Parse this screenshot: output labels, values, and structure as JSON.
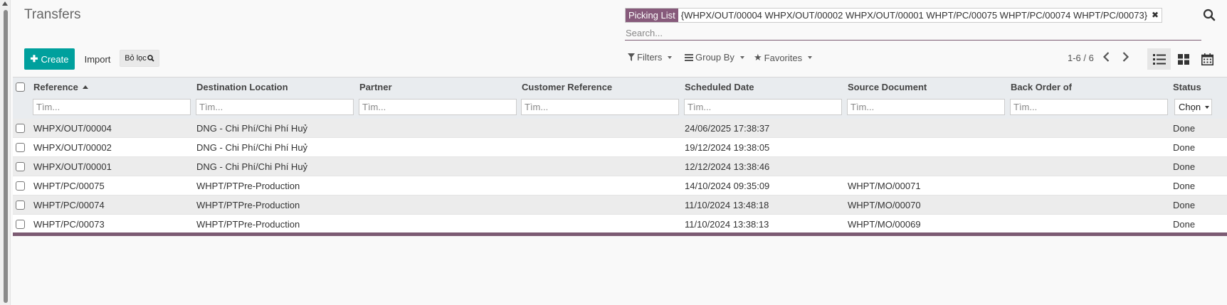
{
  "page_title": "Transfers",
  "search": {
    "facet_label": "Picking List",
    "facet_value": "{WHPX/OUT/00004 WHPX/OUT/00002 WHPX/OUT/00001 WHPT/PC/00075 WHPT/PC/00074 WHPT/PC/00073}",
    "placeholder": "Search..."
  },
  "toolbar": {
    "create_label": "Create",
    "import_label": "Import",
    "boloc_label": "Bỏ lọc",
    "filters_label": "Filters",
    "groupby_label": "Group By",
    "favorites_label": "Favorites",
    "pager_text": "1-6 / 6"
  },
  "table": {
    "columns": [
      "Reference",
      "Destination Location",
      "Partner",
      "Customer Reference",
      "Scheduled Date",
      "Source Document",
      "Back Order of",
      "Status"
    ],
    "filter_placeholder": "Tìm...",
    "status_select_value": "Chọn",
    "rows": [
      {
        "reference": "WHPX/OUT/00004",
        "destination": "DNG - Chi Phí/Chi Phí Huỷ",
        "partner": "",
        "customer_ref": "",
        "scheduled": "24/06/2025 17:38:37",
        "source": "",
        "backorder": "",
        "status": "Done"
      },
      {
        "reference": "WHPX/OUT/00002",
        "destination": "DNG - Chi Phí/Chi Phí Huỷ",
        "partner": "",
        "customer_ref": "",
        "scheduled": "19/12/2024 19:38:05",
        "source": "",
        "backorder": "",
        "status": "Done"
      },
      {
        "reference": "WHPX/OUT/00001",
        "destination": "DNG - Chi Phí/Chi Phí Huỷ",
        "partner": "",
        "customer_ref": "",
        "scheduled": "12/12/2024 13:38:46",
        "source": "",
        "backorder": "",
        "status": "Done"
      },
      {
        "reference": "WHPT/PC/00075",
        "destination": "WHPT/PTPre-Production",
        "partner": "",
        "customer_ref": "",
        "scheduled": "14/10/2024 09:35:09",
        "source": "WHPT/MO/00071",
        "backorder": "",
        "status": "Done"
      },
      {
        "reference": "WHPT/PC/00074",
        "destination": "WHPT/PTPre-Production",
        "partner": "",
        "customer_ref": "",
        "scheduled": "11/10/2024 13:48:18",
        "source": "WHPT/MO/00070",
        "backorder": "",
        "status": "Done"
      },
      {
        "reference": "WHPT/PC/00073",
        "destination": "WHPT/PTPre-Production",
        "partner": "",
        "customer_ref": "",
        "scheduled": "11/10/2024 13:38:13",
        "source": "WHPT/MO/00069",
        "backorder": "",
        "status": "Done"
      }
    ]
  },
  "colors": {
    "accent": "#875a7b",
    "primary_button": "#00a09d"
  }
}
